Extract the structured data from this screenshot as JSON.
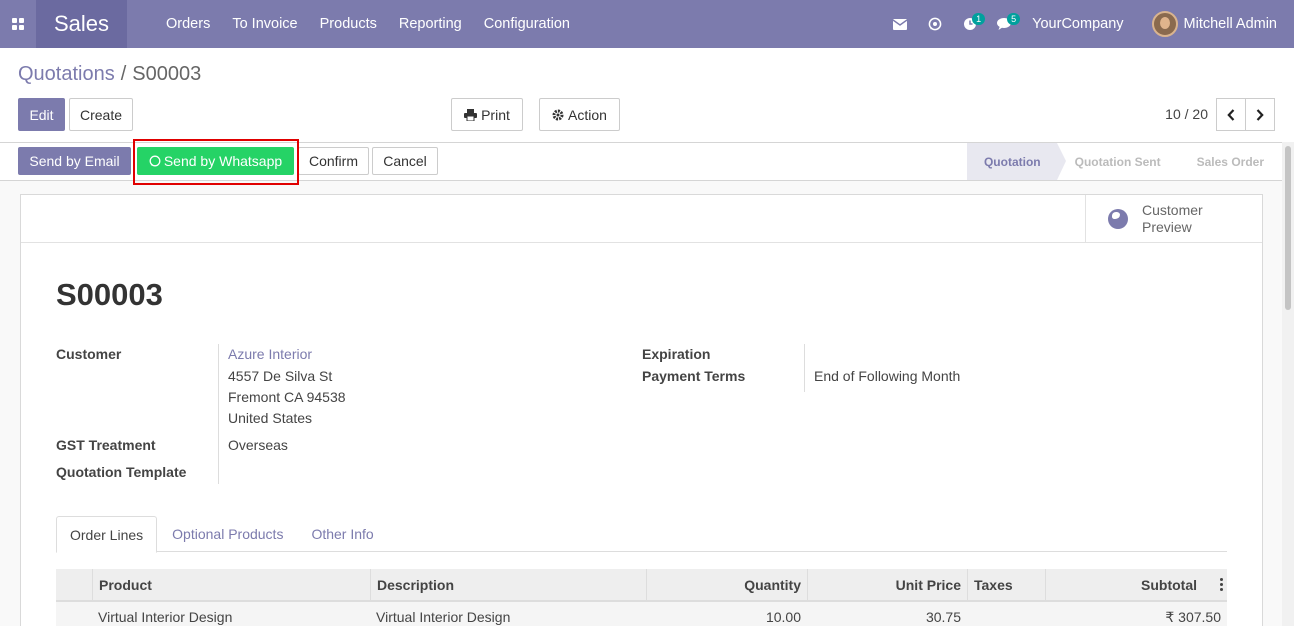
{
  "navbar": {
    "app_name": "Sales",
    "menu": [
      "Orders",
      "To Invoice",
      "Products",
      "Reporting",
      "Configuration"
    ],
    "activity_badge": "1",
    "messages_badge": "5",
    "company": "YourCompany",
    "user": "Mitchell Admin"
  },
  "breadcrumb": {
    "parent": "Quotations",
    "separator": "/",
    "current": "S00003"
  },
  "toolbar": {
    "edit": "Edit",
    "create": "Create",
    "print": "Print",
    "action": "Action"
  },
  "pager": {
    "value": "10 / 20"
  },
  "statusbar": {
    "buttons": {
      "send_email": "Send by Email",
      "send_whatsapp": "Send by Whatsapp",
      "confirm": "Confirm",
      "cancel": "Cancel"
    },
    "stages": [
      "Quotation",
      "Quotation Sent",
      "Sales Order"
    ],
    "active_stage": "Quotation"
  },
  "sheet": {
    "customer_preview": [
      "Customer",
      "Preview"
    ],
    "title": "S00003",
    "fields": {
      "customer_label": "Customer",
      "customer_name": "Azure Interior",
      "address": [
        "4557 De Silva St",
        "Fremont CA 94538",
        "United States"
      ],
      "gst_label": "GST Treatment",
      "gst_value": "Overseas",
      "template_label": "Quotation Template",
      "expiration_label": "Expiration",
      "payment_terms_label": "Payment Terms",
      "payment_terms_value": "End of Following Month"
    },
    "tabs": [
      "Order Lines",
      "Optional Products",
      "Other Info"
    ],
    "table": {
      "headers": [
        "Product",
        "Description",
        "Quantity",
        "Unit Price",
        "Taxes",
        "Subtotal"
      ],
      "rows": [
        {
          "product": "Virtual Interior Design",
          "description": "Virtual Interior Design",
          "quantity": "10.00",
          "unit_price": "30.75",
          "taxes": "",
          "subtotal": "₹ 307.50"
        }
      ]
    }
  },
  "colors": {
    "brand": "#7c7bad",
    "whatsapp": "#25d366",
    "highlight": "#e00000"
  }
}
